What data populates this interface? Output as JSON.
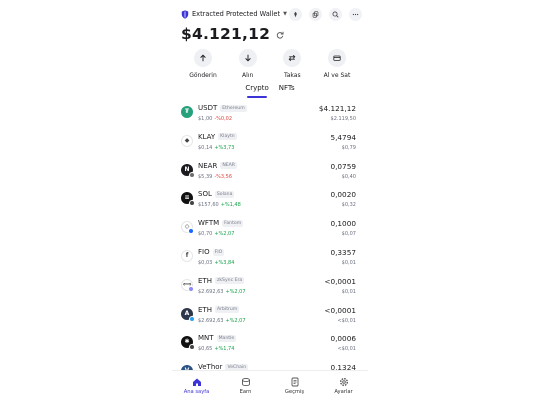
{
  "header": {
    "wallet_name": "Extracted Protected Wallet",
    "icons": [
      "shield-icon",
      "scan-icon",
      "copy-icon",
      "search-icon",
      "more-icon"
    ]
  },
  "balance": {
    "amount": "$4.121,12"
  },
  "actions": [
    {
      "label": "Gönderin",
      "icon": "arrow-up-icon"
    },
    {
      "label": "Alın",
      "icon": "arrow-down-icon"
    },
    {
      "label": "Takas",
      "icon": "swap-icon"
    },
    {
      "label": "Al ve Sat",
      "icon": "card-icon"
    }
  ],
  "tabs": [
    {
      "label": "Crypto",
      "active": true
    },
    {
      "label": "NFTs",
      "active": false
    }
  ],
  "tokens": [
    {
      "symbol": "USDT",
      "network": "Ethereum",
      "price": "$1,00",
      "change": "-%0,02",
      "trend": "down",
      "amount": "$4.121,12",
      "fiat": "$2.119,50",
      "color": "#26a17b",
      "glyph": "₮",
      "badge": ""
    },
    {
      "symbol": "KLAY",
      "network": "Klaytn",
      "price": "$0,14",
      "change": "+%3,73",
      "trend": "up",
      "amount": "5,4794",
      "fiat": "$0,79",
      "color": "#ffffff",
      "glyph": "◆",
      "badge": ""
    },
    {
      "symbol": "NEAR",
      "network": "NEAR",
      "price": "$5,39",
      "change": "-%3,56",
      "trend": "down",
      "amount": "0,0759",
      "fiat": "$0,40",
      "color": "#1b1b1f",
      "glyph": "N",
      "badge": "#6d6d6d"
    },
    {
      "symbol": "SOL",
      "network": "Solana",
      "price": "$157,60",
      "change": "+%1,48",
      "trend": "up",
      "amount": "0,0020",
      "fiat": "$0,32",
      "color": "#111111",
      "glyph": "≡",
      "badge": "#444444"
    },
    {
      "symbol": "WFTM",
      "network": "Fantom",
      "price": "$0,70",
      "change": "+%2,07",
      "trend": "up",
      "amount": "0,1000",
      "fiat": "$0,07",
      "color": "#ffffff",
      "glyph": "◇",
      "badge": "#1969ff"
    },
    {
      "symbol": "FIO",
      "network": "FIO",
      "price": "$0,03",
      "change": "+%3,84",
      "trend": "up",
      "amount": "0,3357",
      "fiat": "$0,01",
      "color": "#ffffff",
      "glyph": "f",
      "badge": ""
    },
    {
      "symbol": "ETH",
      "network": "zkSync Era",
      "price": "$2.692,63",
      "change": "+%2,07",
      "trend": "up",
      "amount": "<0,0001",
      "fiat": "$0,01",
      "color": "#ffffff",
      "glyph": "⟺",
      "badge": "#8c8dfc"
    },
    {
      "symbol": "ETH",
      "network": "Arbitrum",
      "price": "$2.692,63",
      "change": "+%2,07",
      "trend": "up",
      "amount": "<0,0001",
      "fiat": "<$0,01",
      "color": "#2d374b",
      "glyph": "A",
      "badge": "#28a0f0"
    },
    {
      "symbol": "MNT",
      "network": "Mantle",
      "price": "$0,65",
      "change": "+%1,74",
      "trend": "up",
      "amount": "0,0006",
      "fiat": "<$0,01",
      "color": "#111111",
      "glyph": "✱",
      "badge": "#444444"
    },
    {
      "symbol": "VeThor",
      "network": "VeChain",
      "price": "",
      "change": "",
      "trend": "up",
      "amount": "0,1324",
      "fiat": "",
      "color": "#2a5284",
      "glyph": "V",
      "badge": ""
    }
  ],
  "bottom_nav": [
    {
      "label": "Ana sayfa",
      "icon": "home-icon",
      "active": true
    },
    {
      "label": "Earn",
      "icon": "earn-icon",
      "active": false
    },
    {
      "label": "Geçmiş",
      "icon": "history-icon",
      "active": false
    },
    {
      "label": "Ayarlar",
      "icon": "settings-icon",
      "active": false
    }
  ],
  "colors": {
    "accent": "#3c34d6",
    "up": "#17a34a",
    "down": "#e0463e"
  }
}
